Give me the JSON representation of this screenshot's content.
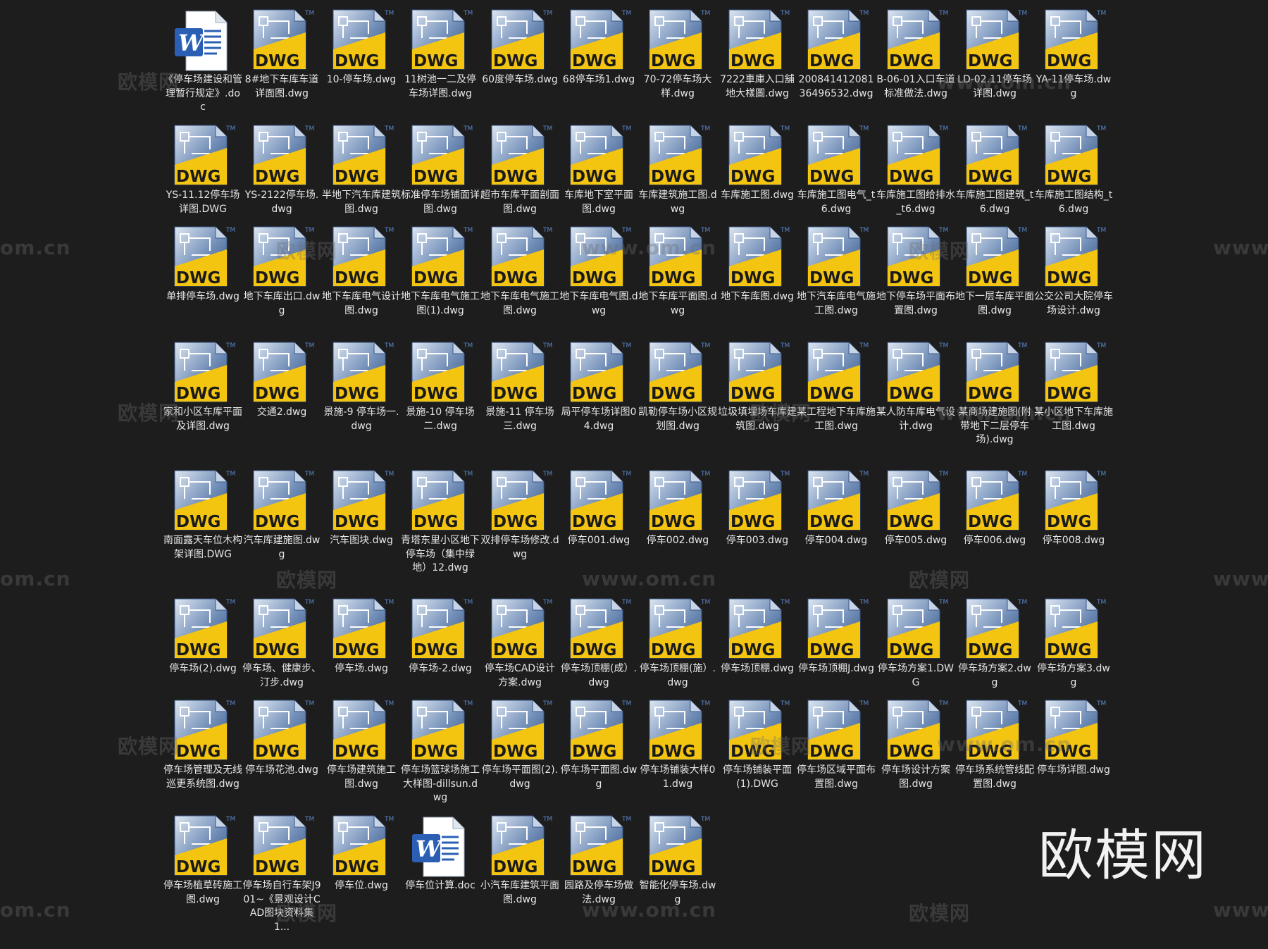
{
  "files": [
    {
      "name": "《停车场建设和管理暂行规定》.doc",
      "type": "doc"
    },
    {
      "name": "8#地下车库车道详面图.dwg",
      "type": "dwg"
    },
    {
      "name": "10-停车场.dwg",
      "type": "dwg"
    },
    {
      "name": "11树池一二及停车场详图.dwg",
      "type": "dwg"
    },
    {
      "name": "60度停车场.dwg",
      "type": "dwg"
    },
    {
      "name": "68停车场1.dwg",
      "type": "dwg"
    },
    {
      "name": "70-72停车场大样.dwg",
      "type": "dwg"
    },
    {
      "name": "7222車庫入口舖地大樣圖.dwg",
      "type": "dwg"
    },
    {
      "name": "20084141208136496532.dwg",
      "type": "dwg"
    },
    {
      "name": "B-06-01入口车道标准做法.dwg",
      "type": "dwg"
    },
    {
      "name": "LD-02.11停车场详图.dwg",
      "type": "dwg"
    },
    {
      "name": "YA-11停车场.dwg",
      "type": "dwg"
    },
    {
      "name": "YS-11.12停车场详图.DWG",
      "type": "dwg"
    },
    {
      "name": "YS-2122停车场.dwg",
      "type": "dwg"
    },
    {
      "name": "半地下汽车库建筑图.dwg",
      "type": "dwg"
    },
    {
      "name": "标准停车场铺面详图.dwg",
      "type": "dwg"
    },
    {
      "name": "超市车库平面剖面图.dwg",
      "type": "dwg"
    },
    {
      "name": "车库地下室平面图.dwg",
      "type": "dwg"
    },
    {
      "name": "车库建筑施工图.dwg",
      "type": "dwg"
    },
    {
      "name": "车库施工图.dwg",
      "type": "dwg"
    },
    {
      "name": "车库施工图电气_t6.dwg",
      "type": "dwg"
    },
    {
      "name": "车库施工图给排水_t6.dwg",
      "type": "dwg"
    },
    {
      "name": "车库施工图建筑_t6.dwg",
      "type": "dwg"
    },
    {
      "name": "车库施工图结构_t6.dwg",
      "type": "dwg"
    },
    {
      "name": "单排停车场.dwg",
      "type": "dwg"
    },
    {
      "name": "地下车库出口.dwg",
      "type": "dwg"
    },
    {
      "name": "地下车库电气设计图.dwg",
      "type": "dwg"
    },
    {
      "name": "地下车库电气施工图(1).dwg",
      "type": "dwg"
    },
    {
      "name": "地下车库电气施工图.dwg",
      "type": "dwg"
    },
    {
      "name": "地下车库电气图.dwg",
      "type": "dwg"
    },
    {
      "name": "地下车库平面图.dwg",
      "type": "dwg"
    },
    {
      "name": "地下车库图.dwg",
      "type": "dwg"
    },
    {
      "name": "地下汽车库电气施工图.dwg",
      "type": "dwg"
    },
    {
      "name": "地下停车场平面布置图.dwg",
      "type": "dwg"
    },
    {
      "name": "地下一层车库平面图.dwg",
      "type": "dwg"
    },
    {
      "name": "公交公司大院停车场设计.dwg",
      "type": "dwg"
    },
    {
      "name": "家和小区车库平面及详图.dwg",
      "type": "dwg"
    },
    {
      "name": "交通2.dwg",
      "type": "dwg"
    },
    {
      "name": "景施-9 停车场一.dwg",
      "type": "dwg"
    },
    {
      "name": "景施-10 停车场二.dwg",
      "type": "dwg"
    },
    {
      "name": "景施-11 停车场三.dwg",
      "type": "dwg"
    },
    {
      "name": "局平停车场详图04.dwg",
      "type": "dwg"
    },
    {
      "name": "凯勒停车场小区规划图.dwg",
      "type": "dwg"
    },
    {
      "name": "垃圾填埋场车库建筑图.dwg",
      "type": "dwg"
    },
    {
      "name": "某工程地下车库施工图.dwg",
      "type": "dwg"
    },
    {
      "name": "某人防车库电气设计.dwg",
      "type": "dwg"
    },
    {
      "name": "某商场建施图(附带地下二层停车场).dwg",
      "type": "dwg"
    },
    {
      "name": "某小区地下车库施工图.dwg",
      "type": "dwg"
    },
    {
      "name": "南面露天车位木构架详图.DWG",
      "type": "dwg"
    },
    {
      "name": "汽车库建施图.dwg",
      "type": "dwg"
    },
    {
      "name": "汽车图块.dwg",
      "type": "dwg"
    },
    {
      "name": "青塔东里小区地下停车场（集中绿地）12.dwg",
      "type": "dwg"
    },
    {
      "name": "双排停车场修改.dwg",
      "type": "dwg"
    },
    {
      "name": "停车001.dwg",
      "type": "dwg"
    },
    {
      "name": "停车002.dwg",
      "type": "dwg"
    },
    {
      "name": "停车003.dwg",
      "type": "dwg"
    },
    {
      "name": "停车004.dwg",
      "type": "dwg"
    },
    {
      "name": "停车005.dwg",
      "type": "dwg"
    },
    {
      "name": "停车006.dwg",
      "type": "dwg"
    },
    {
      "name": "停车008.dwg",
      "type": "dwg"
    },
    {
      "name": "停车场(2).dwg",
      "type": "dwg"
    },
    {
      "name": "停车场、健康步、汀步.dwg",
      "type": "dwg"
    },
    {
      "name": "停车场.dwg",
      "type": "dwg"
    },
    {
      "name": "停车场-2.dwg",
      "type": "dwg"
    },
    {
      "name": "停车场CAD设计方案.dwg",
      "type": "dwg"
    },
    {
      "name": "停车场顶棚(成）.dwg",
      "type": "dwg"
    },
    {
      "name": "停车场顶棚(施）.dwg",
      "type": "dwg"
    },
    {
      "name": "停车场顶棚.dwg",
      "type": "dwg"
    },
    {
      "name": "停车场顶棚J.dwg",
      "type": "dwg"
    },
    {
      "name": "停车场方案1.DWG",
      "type": "dwg"
    },
    {
      "name": "停车场方案2.dwg",
      "type": "dwg"
    },
    {
      "name": "停车场方案3.dwg",
      "type": "dwg"
    },
    {
      "name": "停车场管理及无线巡更系统图.dwg",
      "type": "dwg"
    },
    {
      "name": "停车场花池.dwg",
      "type": "dwg"
    },
    {
      "name": "停车场建筑施工图.dwg",
      "type": "dwg"
    },
    {
      "name": "停车场篮球场施工大样图-dillsun.dwg",
      "type": "dwg"
    },
    {
      "name": "停车场平面图(2).dwg",
      "type": "dwg"
    },
    {
      "name": "停车场平面图.dwg",
      "type": "dwg"
    },
    {
      "name": "停车场铺装大样01.dwg",
      "type": "dwg"
    },
    {
      "name": "停车场铺装平面(1).DWG",
      "type": "dwg"
    },
    {
      "name": "停车场区域平面布置图.dwg",
      "type": "dwg"
    },
    {
      "name": "停车场设计方案图.dwg",
      "type": "dwg"
    },
    {
      "name": "停车场系统管线配置图.dwg",
      "type": "dwg"
    },
    {
      "name": "停车场详图.dwg",
      "type": "dwg"
    },
    {
      "name": "停车场植草砖施工图.dwg",
      "type": "dwg"
    },
    {
      "name": "停车场自行车架J901~《景观设计CAD图块资料集1...",
      "type": "dwg"
    },
    {
      "name": "停车位.dwg",
      "type": "dwg"
    },
    {
      "name": "停车位计算.doc",
      "type": "doc"
    },
    {
      "name": "小汽车库建筑平面图.dwg",
      "type": "dwg"
    },
    {
      "name": "园路及停车场做法.dwg",
      "type": "dwg"
    },
    {
      "name": "智能化停车场.dwg",
      "type": "dwg"
    }
  ],
  "icon_labels": {
    "dwg": "DWG",
    "tm": "TM",
    "doc": "W"
  },
  "watermarks": {
    "cn": "欧模网",
    "url": "www.om.cn",
    "partial": "om.cn",
    "partial_left": "www."
  },
  "brand": "欧模网",
  "colors": {
    "dwg_yellow": "#f3c410",
    "dwg_blue_dark": "#2e4a7a",
    "dwg_blue_light": "#dce6f2",
    "doc_blue": "#2b5fb4"
  }
}
